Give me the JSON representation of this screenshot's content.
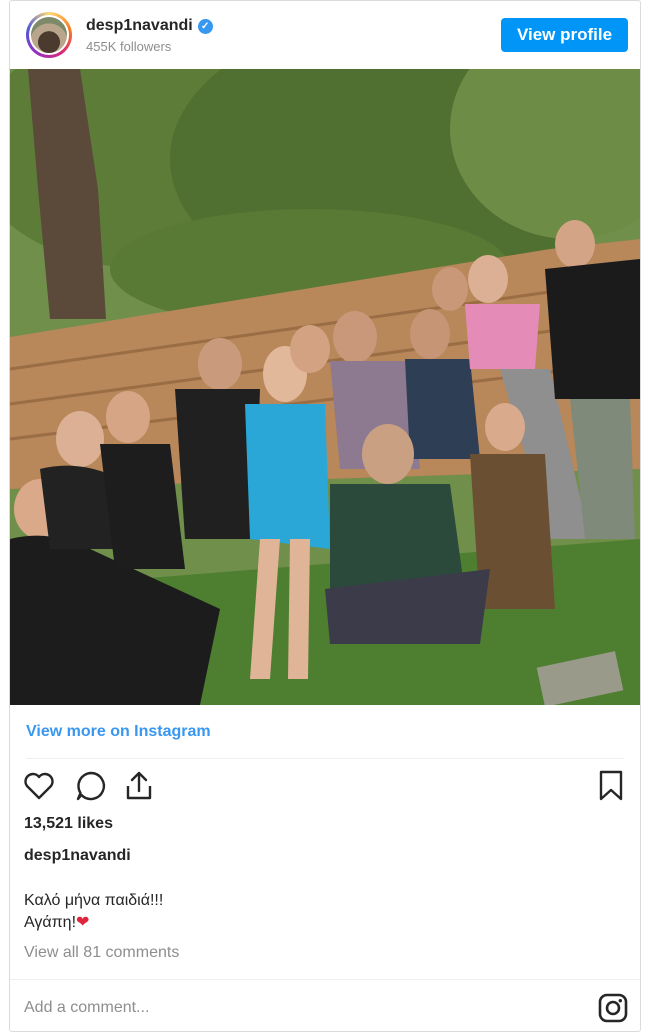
{
  "header": {
    "username": "desp1navandi",
    "verified_mark": "✓",
    "followers": "455K followers",
    "view_profile_label": "View profile",
    "avatar_icon": "profile-avatar"
  },
  "photo": {
    "subject": "group-photo"
  },
  "view_more_label": "View more on Instagram",
  "actions": {
    "icons": [
      "heart-icon",
      "comment-icon",
      "share-icon",
      "bookmark-icon"
    ]
  },
  "likes": "13,521 likes",
  "owner": "desp1navandi",
  "caption": {
    "line1": "Καλό μήνα παιδιά!!!",
    "line2": "Αγάπη!",
    "emoji": "❤"
  },
  "view_comments": "View all 81 comments",
  "comment_placeholder": "Add a comment...",
  "colors": {
    "accent": "#0095f6",
    "link": "#3897f0",
    "muted": "#8e8e8e"
  }
}
